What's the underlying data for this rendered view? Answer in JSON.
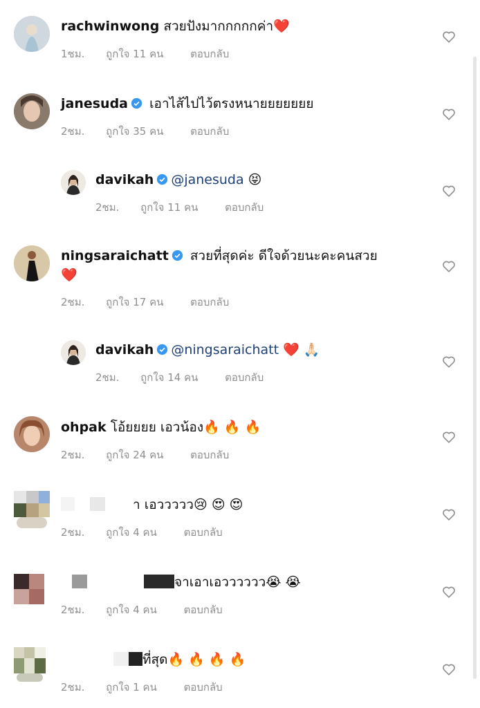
{
  "comments": [
    {
      "username": "rachwinwong",
      "text": "สวยปังมากกกกกค่า",
      "emoji": "❤️",
      "time": "1ชม.",
      "likes": "ถูกใจ 11 คน",
      "reply": "ตอบกลับ"
    },
    {
      "username": "janesuda",
      "text": "เอาไส้ไปไว้ตรงหนายยยยยยย",
      "time": "2ชม.",
      "likes": "ถูกใจ 35 คน",
      "reply": "ตอบกลับ"
    },
    {
      "username": "davikah",
      "mention": "@janesuda",
      "emoji": "😝",
      "time": "2ชม.",
      "likes": "ถูกใจ 11 คน",
      "reply": "ตอบกลับ"
    },
    {
      "username": "ningsaraichatt",
      "text": "สวยที่สุดค่ะ ดีใจด้วยนะคะคนสวย",
      "emoji": "❤️",
      "time": "2ชม.",
      "likes": "ถูกใจ 17 คน",
      "reply": "ตอบกลับ"
    },
    {
      "username": "davikah",
      "mention": "@ningsaraichatt",
      "emoji": "❤️ 🙏🏻",
      "time": "2ชม.",
      "likes": "ถูกใจ 14 คน",
      "reply": "ตอบกลับ"
    },
    {
      "username": "ohpak",
      "text": "โอ้ยยยย เอวน้อง",
      "emoji": "🔥 🔥 🔥",
      "time": "2ชม.",
      "likes": "ถูกใจ 24 คน",
      "reply": "ตอบกลับ"
    },
    {
      "text": "า เอววววว",
      "emoji": "😢 😍 😍",
      "time": "2ชม.",
      "likes": "ถูกใจ 4 คน",
      "reply": "ตอบกลับ"
    },
    {
      "text": "จาเอาเอวววววว",
      "emoji": "😭 😭",
      "time": "2ชม.",
      "likes": "ถูกใจ 4 คน",
      "reply": "ตอบกลับ"
    },
    {
      "text": "ที่สุด",
      "emoji": "🔥 🔥 🔥 🔥",
      "time": "2ชม.",
      "likes": "ถูกใจ 1 คน",
      "reply": "ตอบกลับ"
    }
  ],
  "colors": {
    "meta_gray": "#8e8e8e",
    "mention_blue": "#1d3f7a",
    "verified_blue": "#3897f0"
  },
  "icons": {
    "like": "heart-outline-icon",
    "verified": "verified-badge-icon"
  }
}
